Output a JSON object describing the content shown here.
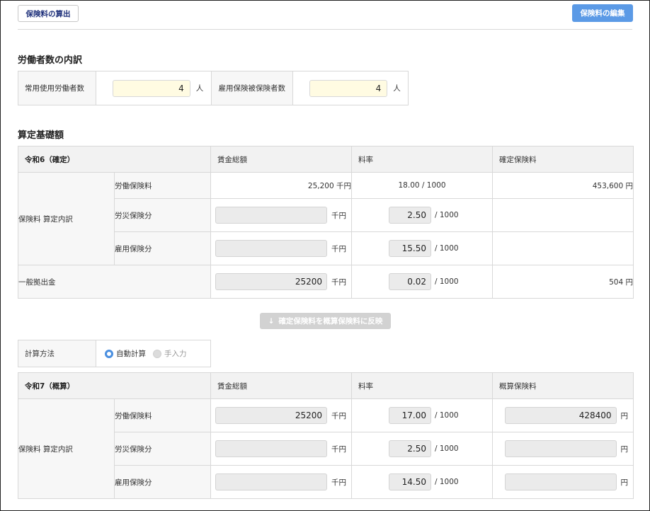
{
  "header": {
    "calc_button": "保険料の算出",
    "edit_button": "保険料の編集"
  },
  "workers": {
    "title": "労働者数の内訳",
    "regular_label": "常用使用労働者数",
    "regular_value": "4",
    "regular_unit": "人",
    "insured_label": "雇用保険被保険者数",
    "insured_value": "4",
    "insured_unit": "人"
  },
  "basis_title": "算定基礎額",
  "r6": {
    "heading": "令和6（確定）",
    "col_wage": "賃金総額",
    "col_rate": "料率",
    "col_premium": "確定保険料",
    "group_label": "保険料 算定内訳",
    "rows": [
      {
        "label": "労働保険料",
        "wage": "25,200",
        "wage_unit": "千円",
        "rate": "18.00 / 1000",
        "premium": "453,600 円"
      },
      {
        "label": "労災保険分",
        "wage": "",
        "wage_unit": "千円",
        "rate": "2.50",
        "rate_unit": "/ 1000",
        "premium": ""
      },
      {
        "label": "雇用保険分",
        "wage": "",
        "wage_unit": "千円",
        "rate": "15.50",
        "rate_unit": "/ 1000",
        "premium": ""
      }
    ],
    "general": {
      "label": "一般拠出金",
      "wage": "25200",
      "wage_unit": "千円",
      "rate": "0.02",
      "rate_unit": "/ 1000",
      "premium": "504 円"
    }
  },
  "reflect_button": "確定保険料を概算保険料に反映",
  "calc_method": {
    "label": "計算方法",
    "auto": "自動計算",
    "manual": "手入力"
  },
  "r7": {
    "heading": "令和7（概算）",
    "col_wage": "賃金総額",
    "col_rate": "料率",
    "col_premium": "概算保険料",
    "group_label": "保険料 算定内訳",
    "rows": [
      {
        "label": "労働保険料",
        "wage": "25200",
        "wage_unit": "千円",
        "rate": "17.00",
        "rate_unit": "/ 1000",
        "premium": "428400",
        "premium_unit": "円"
      },
      {
        "label": "労災保険分",
        "wage": "",
        "wage_unit": "千円",
        "rate": "2.50",
        "rate_unit": "/ 1000",
        "premium": "",
        "premium_unit": "円"
      },
      {
        "label": "雇用保険分",
        "wage": "",
        "wage_unit": "千円",
        "rate": "14.50",
        "rate_unit": "/ 1000",
        "premium": "",
        "premium_unit": "円"
      }
    ]
  }
}
